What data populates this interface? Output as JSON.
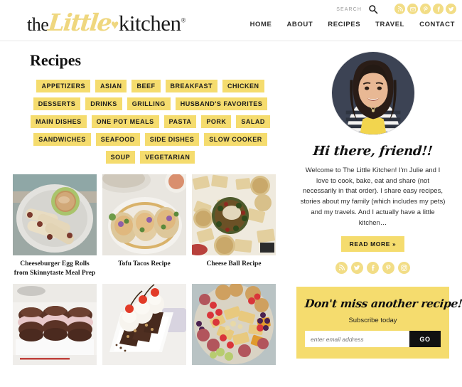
{
  "header": {
    "logo": {
      "the": "the",
      "little": "Little",
      "heart": "♥",
      "kitchen": "kitchen",
      "reg": "®"
    },
    "search": {
      "label": "SEARCH",
      "icon": "search-icon",
      "placeholder": "Search"
    },
    "social": [
      {
        "name": "rss-icon",
        "label": "RSS"
      },
      {
        "name": "email-icon",
        "label": "Email"
      },
      {
        "name": "pinterest-icon",
        "label": "Pinterest"
      },
      {
        "name": "facebook-icon",
        "label": "Facebook"
      },
      {
        "name": "twitter-icon",
        "label": "Twitter"
      }
    ],
    "nav": [
      {
        "label": "HOME"
      },
      {
        "label": "ABOUT"
      },
      {
        "label": "RECIPES"
      },
      {
        "label": "TRAVEL"
      },
      {
        "label": "CONTACT"
      }
    ]
  },
  "main": {
    "page_title": "Recipes",
    "tag_rows": [
      [
        "APPETIZERS",
        "ASIAN",
        "BEEF",
        "BREAKFAST",
        "CHICKEN"
      ],
      [
        "DESSERTS",
        "DRINKS",
        "GRILLING",
        "HUSBAND'S FAVORITES"
      ],
      [
        "MAIN DISHES",
        "ONE POT MEALS",
        "PASTA",
        "PORK",
        "SALAD"
      ],
      [
        "SANDWICHES",
        "SEAFOOD",
        "SIDE DISHES",
        "SLOW COOKER"
      ],
      [
        "SOUP",
        "VEGETARIAN"
      ]
    ],
    "recipes": [
      {
        "title": "Cheeseburger Egg Rolls from Skinnytaste Meal Prep",
        "image": "egg-rolls-with-dipping-sauce"
      },
      {
        "title": "Tofu Tacos Recipe",
        "image": "tofu-tacos-on-plate"
      },
      {
        "title": "Cheese Ball Recipe",
        "image": "cheese-ball-with-crackers"
      },
      {
        "title": "",
        "image": "chocolate-dessert-sandwiches"
      },
      {
        "title": "",
        "image": "brownie-sundae-with-cherries"
      },
      {
        "title": "",
        "image": "charcuterie-board"
      }
    ]
  },
  "sidebar": {
    "avatar_alt": "Julie profile photo",
    "greeting": "Hi there, friend!!",
    "bio": "Welcome to The Little Kitchen! I'm Julie and I love to cook, bake, eat and share (not necessarily in that order). I share easy recipes, stories about my family (which includes my pets) and my travels. And I actually have a little kitchen…",
    "read_more": "READ MORE »",
    "social": [
      {
        "name": "rss-icon",
        "label": "RSS"
      },
      {
        "name": "twitter-icon",
        "label": "Twitter"
      },
      {
        "name": "facebook-icon",
        "label": "Facebook"
      },
      {
        "name": "pinterest-icon",
        "label": "Pinterest"
      },
      {
        "name": "instagram-icon",
        "label": "Instagram"
      }
    ],
    "subscribe": {
      "heading": "Don't miss another recipe!",
      "subheading": "Subscribe today",
      "placeholder": "enter email address",
      "button": "GO",
      "value": ""
    }
  },
  "colors": {
    "accent_yellow": "#f5dc6e",
    "social_yellow": "#f2dd86",
    "logo_yellow": "#efd77f",
    "text_dark": "#1a1a1a",
    "button_dark": "#111111"
  }
}
